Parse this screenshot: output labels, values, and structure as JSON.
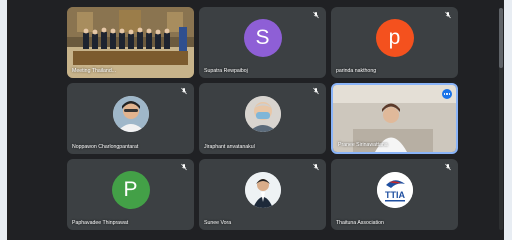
{
  "colors": {
    "stage_background": "#202124",
    "tile_background": "#3c4043",
    "active_border": "#8ab4f8",
    "name_text": "#ffffff"
  },
  "participants": [
    {
      "name": "Meeting Thailand...",
      "type": "video-room",
      "mic": "none"
    },
    {
      "name": "Supatra Rewpaiboj",
      "type": "letter",
      "letter": "S",
      "color": "#8e5fd6",
      "mic": "muted"
    },
    {
      "name": "parinda nakthong",
      "type": "letter",
      "letter": "p",
      "color": "#f4511e",
      "mic": "muted"
    },
    {
      "name": "Noppawon Charlongpantarat",
      "type": "photo-avatar",
      "mic": "muted"
    },
    {
      "name": "Jiraphant anvatanakul",
      "type": "photo-avatar",
      "mic": "muted"
    },
    {
      "name": "Pranee Sirinawattana",
      "type": "video-person",
      "mic": "none",
      "active": true,
      "menu_icon": "more-options-icon"
    },
    {
      "name": "Paphavadee Thinprawat",
      "type": "letter",
      "letter": "P",
      "color": "#43a047",
      "mic": "muted"
    },
    {
      "name": "Sunee Vora",
      "type": "photo-avatar",
      "mic": "muted"
    },
    {
      "name": "Thaituna Association",
      "type": "logo",
      "logo_text": "TTIA",
      "mic": "muted"
    }
  ]
}
